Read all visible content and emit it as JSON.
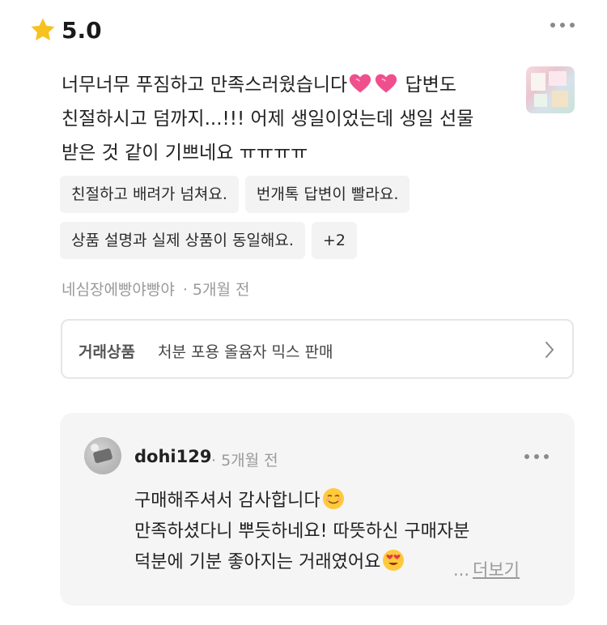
{
  "rating": {
    "value": "5.0",
    "icon": "star-icon",
    "star_color": "#F7C21F"
  },
  "review": {
    "line1": "너무너무 푸짐하고 만족스러웠습니다",
    "line1_after": "답변도",
    "line2": "친절하시고 덤까지...!!! 어제 생일이었는데 생일 선물",
    "line3": "받은 것 같이 기쁘네요 ㅠㅠㅠㅠ",
    "emoji": "pink-heart-icon"
  },
  "tags": [
    "친절하고 배려가 넘쳐요.",
    "번개톡 답변이 빨라요.",
    "상품 설명과 실제 상품이 동일해요.",
    "+2"
  ],
  "meta": {
    "author": "네심장에빵야빵야",
    "separator": "·",
    "time": "5개월 전"
  },
  "product": {
    "label": "거래상품",
    "name": "처분 포용 올윰자 믹스 판매"
  },
  "reply": {
    "user": "dohi129",
    "time": "· 5개월 전",
    "line1": "구매해주셔서 감사합니다",
    "line2": "만족하셨다니 뿌듯하네요! 따뜻하신 구매자분",
    "line3": "덕분에 기분 좋아지는 거래였어요",
    "more_prefix": "...",
    "more_label": "더보기"
  }
}
